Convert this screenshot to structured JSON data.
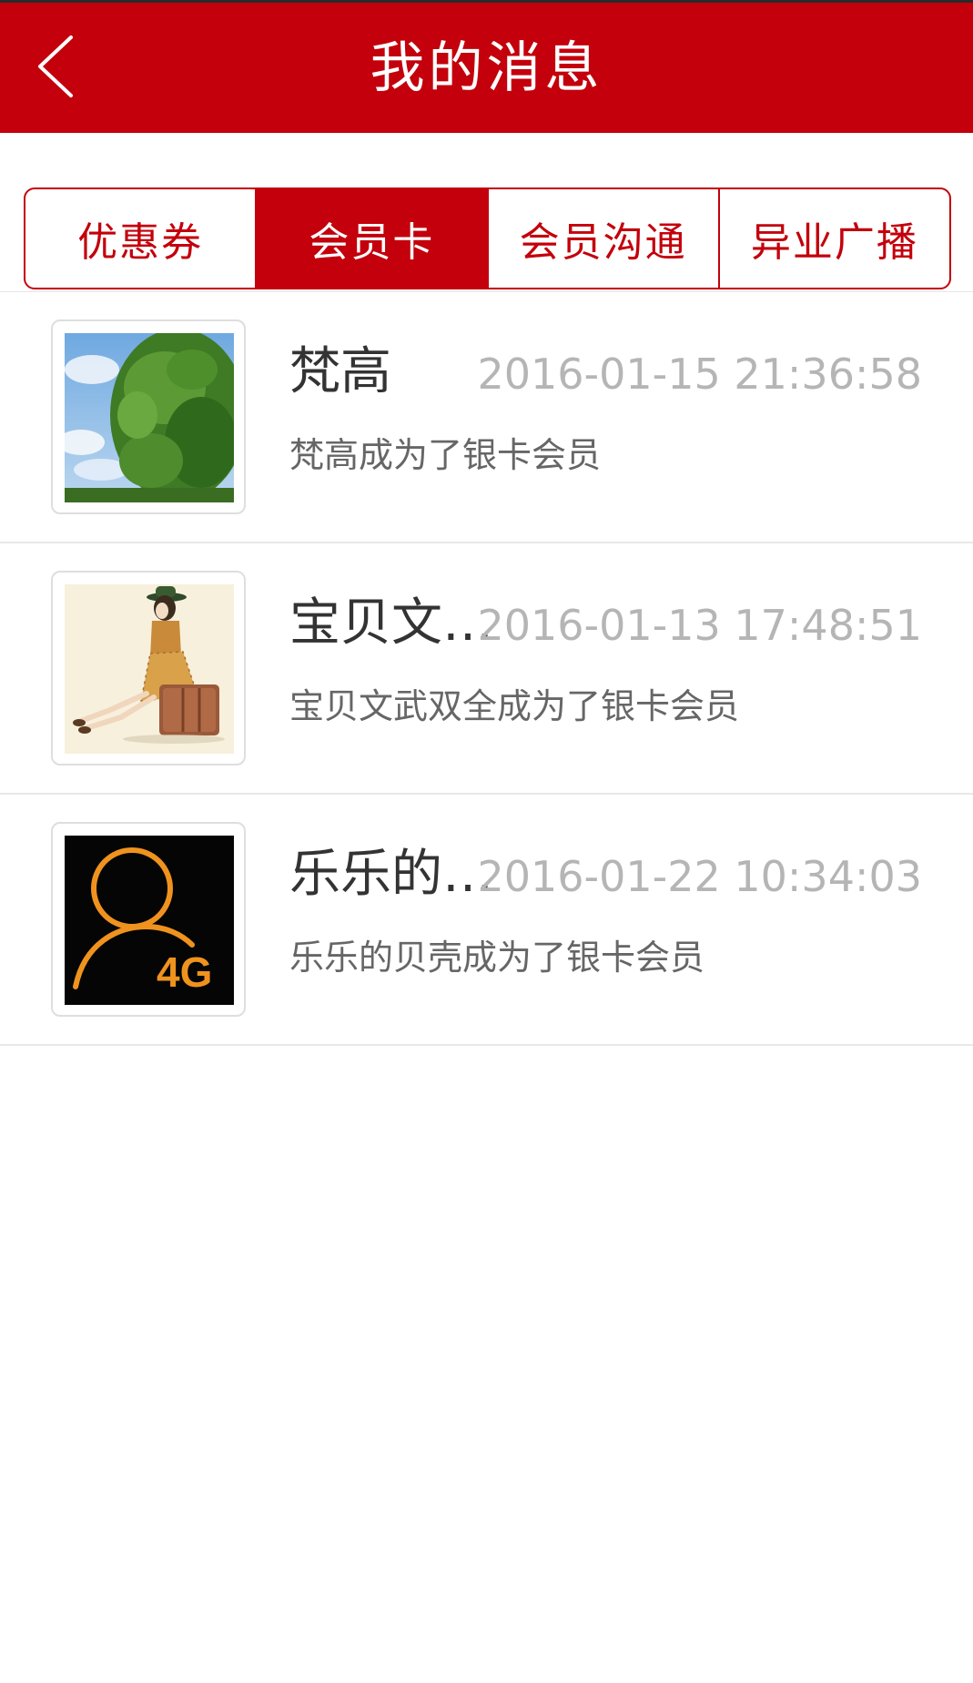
{
  "header": {
    "title": "我的消息",
    "back_icon": "chevron-left-icon"
  },
  "tabs": [
    {
      "label": "优惠券",
      "active": false
    },
    {
      "label": "会员卡",
      "active": true
    },
    {
      "label": "会员沟通",
      "active": false
    },
    {
      "label": "异业广播",
      "active": false
    }
  ],
  "messages": [
    {
      "name": "梵高",
      "time": "2016-01-15 21:36:58",
      "text": "梵高成为了银卡会员",
      "avatar": "tree-sky-photo"
    },
    {
      "name": "宝贝文…",
      "time": "2016-01-13 17:48:51",
      "text": "宝贝文武双全成为了银卡会员",
      "avatar": "girl-on-suitcase-illustration"
    },
    {
      "name": "乐乐的…",
      "time": "2016-01-22 10:34:03",
      "text": "乐乐的贝壳成为了银卡会员",
      "avatar": "user-4g-icon",
      "avatar_label": "4G"
    }
  ],
  "colors": {
    "brand_red": "#c3000b",
    "time_gray": "#b5b5b5",
    "text_gray": "#666666",
    "avatar_orange": "#f0921e"
  }
}
